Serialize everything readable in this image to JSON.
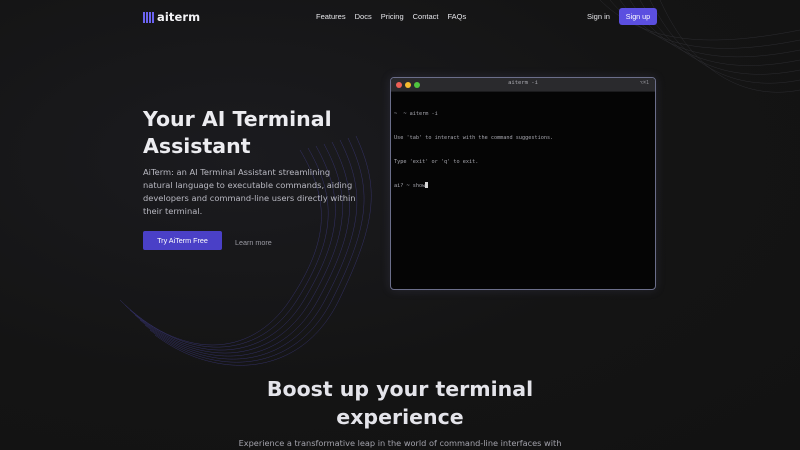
{
  "nav": {
    "logo_text": "aiterm",
    "links": [
      {
        "label": "Features"
      },
      {
        "label": "Docs"
      },
      {
        "label": "Pricing"
      },
      {
        "label": "Contact"
      },
      {
        "label": "FAQs"
      }
    ],
    "signin_label": "Sign in",
    "signup_label": "Sign up"
  },
  "hero": {
    "title_line1": "Your AI Terminal",
    "title_line2": "Assistant",
    "description": "AiTerm: an AI Terminal Assistant streamlining natural language to executable commands, aiding developers and command-line users directly within their terminal.",
    "cta_label": "Try AiTerm Free",
    "learn_more_label": "Learn more"
  },
  "terminal": {
    "title": "aiterm -i",
    "shortcut": "⌥⌘1",
    "lines": [
      "~  ~ aiterm -i",
      "Use 'tab' to interact with the command suggestions.",
      "Type 'exit' or 'q' to exit.",
      "ai? ~ show"
    ]
  },
  "section": {
    "title_line1": "Boost up your terminal",
    "title_line2": "experience",
    "subtitle": "Experience a transformative leap in the world of command-line interfaces with"
  },
  "colors": {
    "accent": "#5b4fe0",
    "cta": "#4a40c7",
    "background": "#131313"
  },
  "icons": {
    "logo": "bars-logo-icon",
    "window_close": "close-dot-icon",
    "window_minimize": "minimize-dot-icon",
    "window_maximize": "maximize-dot-icon"
  }
}
